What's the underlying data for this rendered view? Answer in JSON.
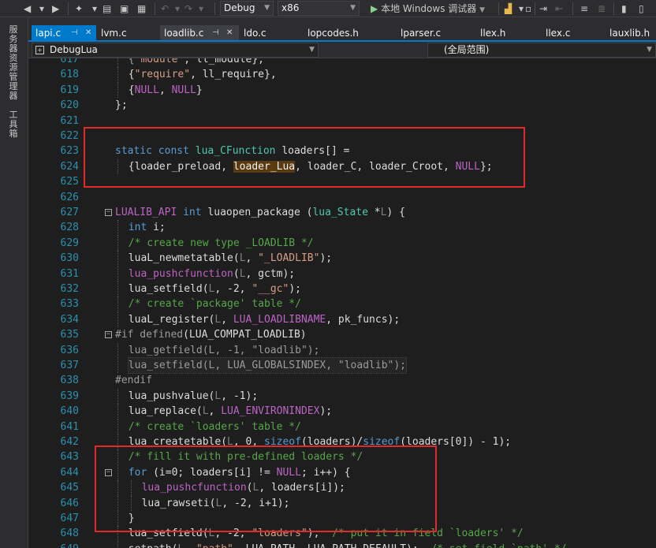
{
  "toolbar": {
    "config": "Debug",
    "platform": "x86",
    "run_label": "本地 Windows 调试器"
  },
  "left_panel": {
    "solution_explorer": "服务器资源管理器",
    "toolbox": "工具箱"
  },
  "tabs": [
    {
      "label": "lapi.c",
      "state": "active",
      "pinned": true
    },
    {
      "label": "lvm.c"
    },
    {
      "label": "loadlib.c",
      "state": "preview",
      "pinned": true
    },
    {
      "label": "ldo.c"
    },
    {
      "label": "lopcodes.h"
    },
    {
      "label": "lparser.c"
    },
    {
      "label": "llex.h"
    },
    {
      "label": "llex.c"
    },
    {
      "label": "lauxlib.h"
    }
  ],
  "nav": {
    "project": "DebugLua",
    "scope": "(全局范围)"
  },
  "editor": {
    "lines": [
      {
        "n": "617",
        "indent": 1,
        "tokens": [
          [
            "pr",
            "{"
          ],
          [
            "st",
            "\"module\""
          ],
          [
            "id",
            ", ll_module},"
          ]
        ]
      },
      {
        "n": "618",
        "indent": 1,
        "tokens": [
          [
            "id",
            "{"
          ],
          [
            "st",
            "\"require\""
          ],
          [
            "id",
            ", ll_require},"
          ]
        ]
      },
      {
        "n": "619",
        "indent": 1,
        "tokens": [
          [
            "id",
            "{"
          ],
          [
            "mc",
            "NULL"
          ],
          [
            "id",
            ", "
          ],
          [
            "mc",
            "NULL"
          ],
          [
            "id",
            "}"
          ]
        ]
      },
      {
        "n": "620",
        "indent": 0,
        "tokens": [
          [
            "id",
            "};"
          ]
        ]
      },
      {
        "n": "621",
        "indent": 0,
        "tokens": []
      },
      {
        "n": "622",
        "indent": 0,
        "tokens": []
      },
      {
        "n": "623",
        "indent": 0,
        "tokens": [
          [
            "kw",
            "static const "
          ],
          [
            "ty",
            "lua_CFunction"
          ],
          [
            "id",
            " loaders[] ="
          ]
        ]
      },
      {
        "n": "624",
        "indent": 1,
        "tokens": [
          [
            "id",
            "{loader_preload, "
          ],
          [
            "hl",
            "loader_Lua"
          ],
          [
            "id",
            ", loader_C, loader_Croot, "
          ],
          [
            "mc",
            "NULL"
          ],
          [
            "id",
            "};"
          ]
        ]
      },
      {
        "n": "625",
        "indent": 0,
        "tokens": []
      },
      {
        "n": "626",
        "indent": 0,
        "tokens": []
      },
      {
        "n": "627",
        "indent": 0,
        "fold": "−",
        "tokens": [
          [
            "mc",
            "LUALIB_API"
          ],
          [
            "id",
            " "
          ],
          [
            "kw",
            "int"
          ],
          [
            "id",
            " luaopen_package ("
          ],
          [
            "ty",
            "lua_State"
          ],
          [
            "id",
            " *"
          ],
          [
            "par",
            "L"
          ],
          [
            "id",
            ") {"
          ]
        ]
      },
      {
        "n": "628",
        "indent": 1,
        "tokens": [
          [
            "kw",
            "int"
          ],
          [
            "id",
            " i;"
          ]
        ]
      },
      {
        "n": "629",
        "indent": 1,
        "tokens": [
          [
            "cm",
            "/* create new type _LOADLIB */"
          ]
        ]
      },
      {
        "n": "630",
        "indent": 1,
        "tokens": [
          [
            "id",
            "luaL_newmetatable("
          ],
          [
            "par",
            "L"
          ],
          [
            "id",
            ", "
          ],
          [
            "st",
            "\"_LOADLIB\""
          ],
          [
            "id",
            ");"
          ]
        ]
      },
      {
        "n": "631",
        "indent": 1,
        "tokens": [
          [
            "mc",
            "lua_pushcfunction"
          ],
          [
            "id",
            "("
          ],
          [
            "par",
            "L"
          ],
          [
            "id",
            ", gctm);"
          ]
        ]
      },
      {
        "n": "632",
        "indent": 1,
        "tokens": [
          [
            "id",
            "lua_setfield("
          ],
          [
            "par",
            "L"
          ],
          [
            "id",
            ", -2, "
          ],
          [
            "st",
            "\"__gc\""
          ],
          [
            "id",
            ");"
          ]
        ]
      },
      {
        "n": "633",
        "indent": 1,
        "tokens": [
          [
            "cm",
            "/* create `package' table */"
          ]
        ]
      },
      {
        "n": "634",
        "indent": 1,
        "tokens": [
          [
            "id",
            "luaL_register("
          ],
          [
            "par",
            "L"
          ],
          [
            "id",
            ", "
          ],
          [
            "mc",
            "LUA_LOADLIBNAME"
          ],
          [
            "id",
            ", pk_funcs);"
          ]
        ]
      },
      {
        "n": "635",
        "indent": 0,
        "fold": "−",
        "tokens": [
          [
            "pr",
            "#if defined"
          ],
          [
            "id",
            "(LUA_COMPAT_LOADLIB)"
          ]
        ]
      },
      {
        "n": "636",
        "indent": 1,
        "dim": true,
        "tokens": [
          [
            "dim",
            "lua_getfield(L, -1, \"loadlib\");"
          ]
        ]
      },
      {
        "n": "637",
        "indent": 1,
        "dim": true,
        "box": true,
        "tokens": [
          [
            "dim",
            "lua_setfield(L, LUA_GLOBALSINDEX, \"loadlib\");"
          ]
        ]
      },
      {
        "n": "638",
        "indent": 0,
        "tokens": [
          [
            "pr",
            "#endif"
          ]
        ]
      },
      {
        "n": "639",
        "indent": 1,
        "tokens": [
          [
            "id",
            "lua_pushvalue("
          ],
          [
            "par",
            "L"
          ],
          [
            "id",
            ", -1);"
          ]
        ]
      },
      {
        "n": "640",
        "indent": 1,
        "tokens": [
          [
            "id",
            "lua_replace("
          ],
          [
            "par",
            "L"
          ],
          [
            "id",
            ", "
          ],
          [
            "mc",
            "LUA_ENVIRONINDEX"
          ],
          [
            "id",
            ");"
          ]
        ]
      },
      {
        "n": "641",
        "indent": 1,
        "tokens": [
          [
            "cm",
            "/* create `loaders' table */"
          ]
        ]
      },
      {
        "n": "642",
        "indent": 1,
        "tokens": [
          [
            "id",
            "lua_createtable("
          ],
          [
            "par",
            "L"
          ],
          [
            "id",
            ", 0, "
          ],
          [
            "kw",
            "sizeof"
          ],
          [
            "id",
            "(loaders)/"
          ],
          [
            "kw",
            "sizeof"
          ],
          [
            "id",
            "(loaders[0]) - 1);"
          ]
        ]
      },
      {
        "n": "643",
        "indent": 1,
        "tokens": [
          [
            "cm",
            "/* fill it with pre-defined loaders */"
          ]
        ]
      },
      {
        "n": "644",
        "indent": 1,
        "fold": "−",
        "tokens": [
          [
            "kw",
            "for"
          ],
          [
            "id",
            " (i=0; loaders[i] != "
          ],
          [
            "mc",
            "NULL"
          ],
          [
            "id",
            "; i++) {"
          ]
        ]
      },
      {
        "n": "645",
        "indent": 2,
        "tokens": [
          [
            "mc",
            "lua_pushcfunction"
          ],
          [
            "id",
            "("
          ],
          [
            "par",
            "L"
          ],
          [
            "id",
            ", loaders[i]);"
          ]
        ]
      },
      {
        "n": "646",
        "indent": 2,
        "tokens": [
          [
            "id",
            "lua_rawseti("
          ],
          [
            "par",
            "L"
          ],
          [
            "id",
            ", -2, i+1);"
          ]
        ]
      },
      {
        "n": "647",
        "indent": 1,
        "tokens": [
          [
            "id",
            "}"
          ]
        ]
      },
      {
        "n": "648",
        "indent": 1,
        "tokens": [
          [
            "id",
            "lua_setfield("
          ],
          [
            "par",
            "L"
          ],
          [
            "id",
            ", -2, "
          ],
          [
            "st",
            "\"loaders\""
          ],
          [
            "id",
            ");  "
          ],
          [
            "cm",
            "/* put it in field `loaders' */"
          ]
        ]
      },
      {
        "n": "649",
        "indent": 1,
        "tokens": [
          [
            "id",
            "setpath("
          ],
          [
            "par",
            "L"
          ],
          [
            "id",
            ", "
          ],
          [
            "st",
            "\"path\""
          ],
          [
            "id",
            ", LUA_PATH, LUA_PATH_DEFAULT);  "
          ],
          [
            "cm",
            "/* set field `path' */"
          ]
        ]
      }
    ]
  }
}
